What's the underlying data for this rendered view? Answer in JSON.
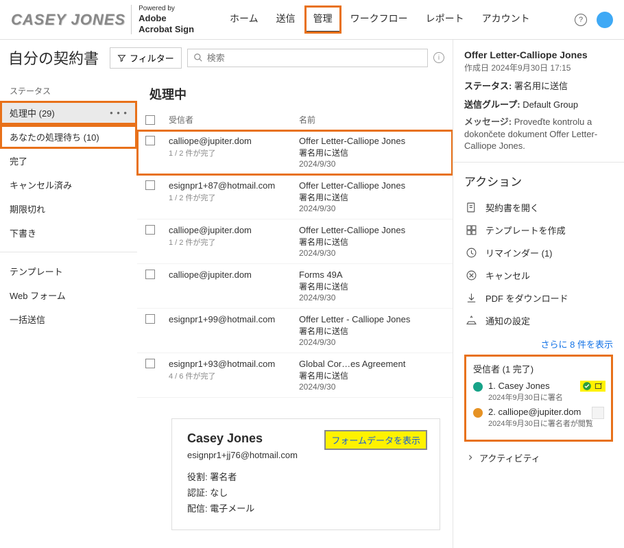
{
  "header": {
    "logo": "CASEY JONES",
    "powered_by": "Powered by",
    "brand": "Adobe\nAcrobat Sign",
    "nav": [
      "ホーム",
      "送信",
      "管理",
      "ワークフロー",
      "レポート",
      "アカウント"
    ],
    "nav_active_index": 2
  },
  "topbar": {
    "title": "自分の契約書",
    "filter": "フィルター",
    "search_placeholder": "検索"
  },
  "sidebar": {
    "status_heading": "ステータス",
    "items": [
      {
        "label": "処理中",
        "count": "(29)",
        "selected": true,
        "hl": true,
        "dots": true
      },
      {
        "label": "あなたの処理待ち",
        "count": "(10)",
        "hl": true
      },
      {
        "label": "完了"
      },
      {
        "label": "キャンセル済み"
      },
      {
        "label": "期限切れ"
      },
      {
        "label": "下書き"
      }
    ],
    "items2": [
      {
        "label": "テンプレート"
      },
      {
        "label": "Web フォーム"
      },
      {
        "label": "一括送信"
      }
    ]
  },
  "list": {
    "title": "処理中",
    "col_recipient": "受信者",
    "col_name": "名前",
    "rows": [
      {
        "email": "calliope@jupiter.dom",
        "sub": "1 / 2 件が完了",
        "name": "Offer Letter-Calliope Jones",
        "status": "署名用に送信",
        "date": "2024/9/30",
        "hl": true
      },
      {
        "email": "esignpr1+87@hotmail.com",
        "sub": "1 / 2 件が完了",
        "name": "Offer Letter-Calliope Jones",
        "status": "署名用に送信",
        "date": "2024/9/30"
      },
      {
        "email": "calliope@jupiter.dom",
        "sub": "1 / 2 件が完了",
        "name": "Offer Letter-Calliope Jones",
        "status": "署名用に送信",
        "date": "2024/9/30"
      },
      {
        "email": "calliope@jupiter.dom",
        "sub": "",
        "name": "Forms 49A",
        "status": "署名用に送信",
        "date": "2024/9/30"
      },
      {
        "email": "esignpr1+99@hotmail.com",
        "sub": "",
        "name": "Offer Letter - Calliope Jones",
        "status": "署名用に送信",
        "date": "2024/9/30"
      },
      {
        "email": "esignpr1+93@hotmail.com",
        "sub": "4 / 6 件が完了",
        "name": "Global Cor…es Agreement",
        "status": "署名用に送信",
        "date": "2024/9/30"
      }
    ]
  },
  "detail": {
    "name": "Casey Jones",
    "email": "esignpr1+jj76@hotmail.com",
    "role_label": "役割:",
    "role": "署名者",
    "auth_label": "認証:",
    "auth": "なし",
    "delivery_label": "配信:",
    "delivery": "電子メール",
    "form_data_btn": "フォームデータを表示"
  },
  "right": {
    "title": "Offer Letter-Calliope Jones",
    "created_label": "作成日",
    "created": "2024年9月30日 17:15",
    "status_label": "ステータス:",
    "status": "署名用に送信",
    "group_label": "送信グループ:",
    "group": "Default Group",
    "msg_label": "メッセージ:",
    "msg": "Proveďte kontrolu a dokončete dokument Offer Letter-Calliope Jones.",
    "actions_title": "アクション",
    "actions": [
      {
        "label": "契約書を開く",
        "icon": "open"
      },
      {
        "label": "テンプレートを作成",
        "icon": "template"
      },
      {
        "label": "リマインダー (1)",
        "icon": "reminder"
      },
      {
        "label": "キャンセル",
        "icon": "cancel"
      },
      {
        "label": "PDF をダウンロード",
        "icon": "download"
      },
      {
        "label": "通知の設定",
        "icon": "notify"
      }
    ],
    "more": "さらに 8 件を表示",
    "recipients_title": "受信者 (1 完了)",
    "recipients": [
      {
        "n": "1. Casey Jones",
        "d": "2024年9月30日に署名",
        "color": "#17a388",
        "done": true
      },
      {
        "n": "2. calliope@jupiter.dom",
        "d": "2024年9月30日に署名者が閲覧",
        "color": "#e69224",
        "done": false
      }
    ],
    "activity": "アクティビティ"
  }
}
